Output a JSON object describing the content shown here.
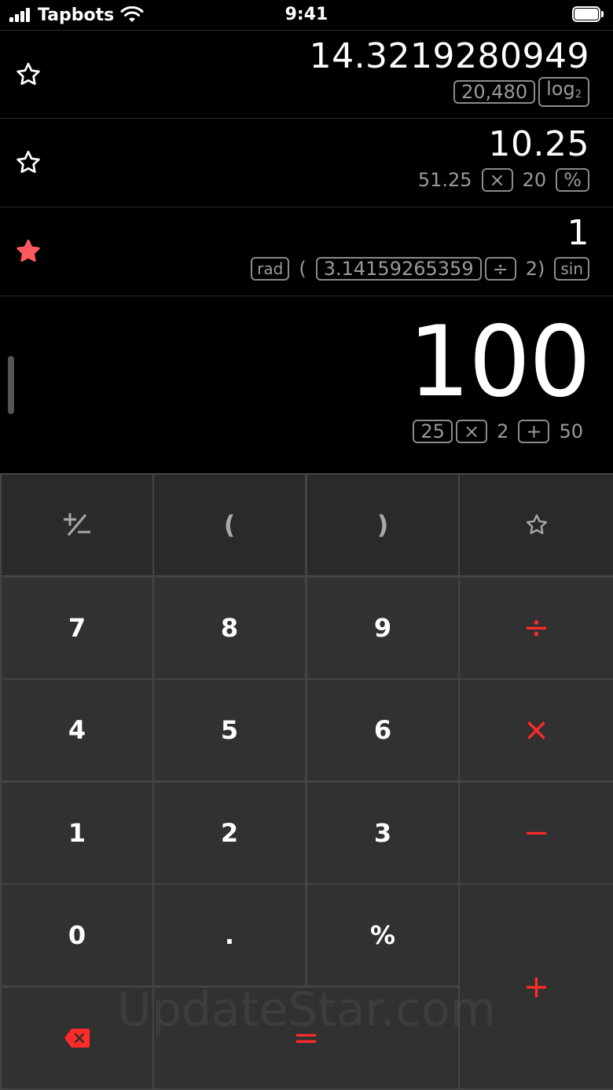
{
  "status_bar": {
    "carrier": "Tapbots",
    "time": "9:41"
  },
  "history": [
    {
      "favorite": false,
      "result": "14.3219280949",
      "expression": [
        {
          "text": "20,480",
          "boxed": true
        },
        {
          "text": "log",
          "sub": "2",
          "boxed": true
        }
      ]
    },
    {
      "favorite": false,
      "result": "10.25",
      "expression": [
        {
          "text": "51.25",
          "boxed": false
        },
        {
          "text": "×",
          "boxed": true
        },
        {
          "text": "20",
          "boxed": false
        },
        {
          "text": "%",
          "boxed": true
        }
      ]
    },
    {
      "favorite": true,
      "result": "1",
      "expression": [
        {
          "text": "rad",
          "boxed": true,
          "small": true
        },
        {
          "text": "(",
          "boxed": false
        },
        {
          "text": "3.14159265359",
          "boxed": true
        },
        {
          "text": "÷",
          "boxed": true
        },
        {
          "text": "2)",
          "boxed": false
        },
        {
          "text": "sin",
          "boxed": true,
          "small": true
        }
      ]
    }
  ],
  "current": {
    "result": "100",
    "expression": [
      {
        "text": "25",
        "boxed": true
      },
      {
        "text": "×",
        "boxed": true
      },
      {
        "text": "2",
        "boxed": false
      },
      {
        "text": "+",
        "boxed": true
      },
      {
        "text": "50",
        "boxed": false
      }
    ]
  },
  "keypad": {
    "plus_minus": "+/−",
    "open_paren": "(",
    "close_paren": ")",
    "favorite": "☆",
    "seven": "7",
    "eight": "8",
    "nine": "9",
    "divide": "÷",
    "four": "4",
    "five": "5",
    "six": "6",
    "multiply": "×",
    "one": "1",
    "two": "2",
    "three": "3",
    "minus": "−",
    "zero": "0",
    "decimal": ".",
    "percent": "%",
    "plus": "+",
    "equals": "=",
    "backspace": "backspace-icon"
  },
  "colors": {
    "accent": "#ff2a2a",
    "favorite_star": "#ff5a5f",
    "key": "#313131",
    "key_top": "#2a2a2a"
  },
  "watermark": "UpdateStar.com"
}
